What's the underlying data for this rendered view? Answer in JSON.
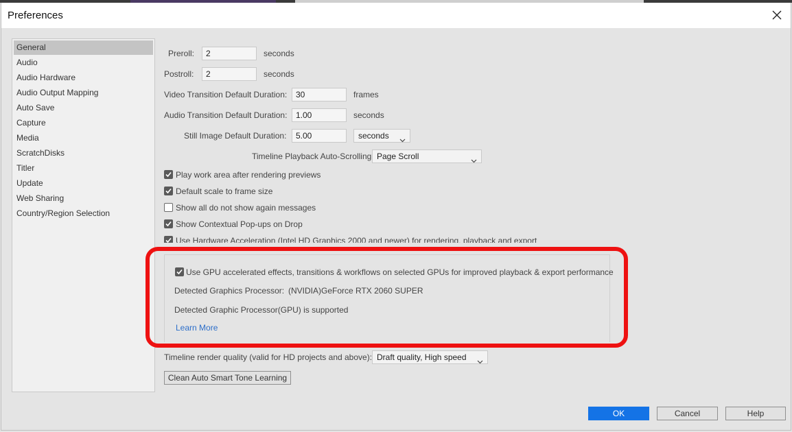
{
  "window": {
    "title": "Preferences"
  },
  "sidebar": {
    "items": [
      {
        "label": "General",
        "selected": true
      },
      {
        "label": "Audio"
      },
      {
        "label": "Audio Hardware"
      },
      {
        "label": "Audio Output Mapping"
      },
      {
        "label": "Auto Save"
      },
      {
        "label": "Capture"
      },
      {
        "label": "Media"
      },
      {
        "label": "ScratchDisks"
      },
      {
        "label": "Titler"
      },
      {
        "label": "Update"
      },
      {
        "label": "Web Sharing"
      },
      {
        "label": "Country/Region Selection"
      }
    ]
  },
  "general": {
    "preroll": {
      "label": "Preroll:",
      "value": "2",
      "unit": "seconds"
    },
    "postroll": {
      "label": "Postroll:",
      "value": "2",
      "unit": "seconds"
    },
    "video_transition": {
      "label": "Video Transition Default Duration:",
      "value": "30",
      "unit": "frames"
    },
    "audio_transition": {
      "label": "Audio Transition Default Duration:",
      "value": "1.00",
      "unit": "seconds"
    },
    "still_image": {
      "label": "Still Image Default Duration:",
      "value": "5.00",
      "unit_selected": "seconds"
    },
    "timeline_scroll": {
      "label": "Timeline Playback Auto-Scrolling:",
      "selected": "Page Scroll"
    },
    "checkboxes": [
      {
        "label": "Play work area after rendering previews",
        "checked": true
      },
      {
        "label": "Default scale to frame size",
        "checked": true
      },
      {
        "label": "Show all do not show again messages",
        "checked": false
      },
      {
        "label": "Show Contextual Pop-ups on Drop",
        "checked": true
      },
      {
        "label": "Use Hardware Acceleration (Intel HD Graphics 2000 and newer) for rendering, playback and export",
        "checked": true
      }
    ],
    "gpu": {
      "checkbox_label": "Use GPU accelerated effects, transitions & workflows on selected GPUs for improved playback & export performance",
      "checked": true,
      "processor_label": "Detected Graphics Processor:",
      "processor_value": "(NVIDIA)GeForce RTX 2060 SUPER",
      "supported_text": "Detected Graphic Processor(GPU) is supported",
      "learn_more": "Learn More"
    },
    "render_quality": {
      "label": "Timeline render quality (valid for HD projects and above):",
      "selected": "Draft quality, High speed"
    },
    "clean_button": "Clean Auto Smart Tone Learning"
  },
  "footer": {
    "ok": "OK",
    "cancel": "Cancel",
    "help": "Help"
  },
  "colors": {
    "accent": "#1473e6",
    "highlight": "#ee1111",
    "link": "#2c6ec9"
  }
}
